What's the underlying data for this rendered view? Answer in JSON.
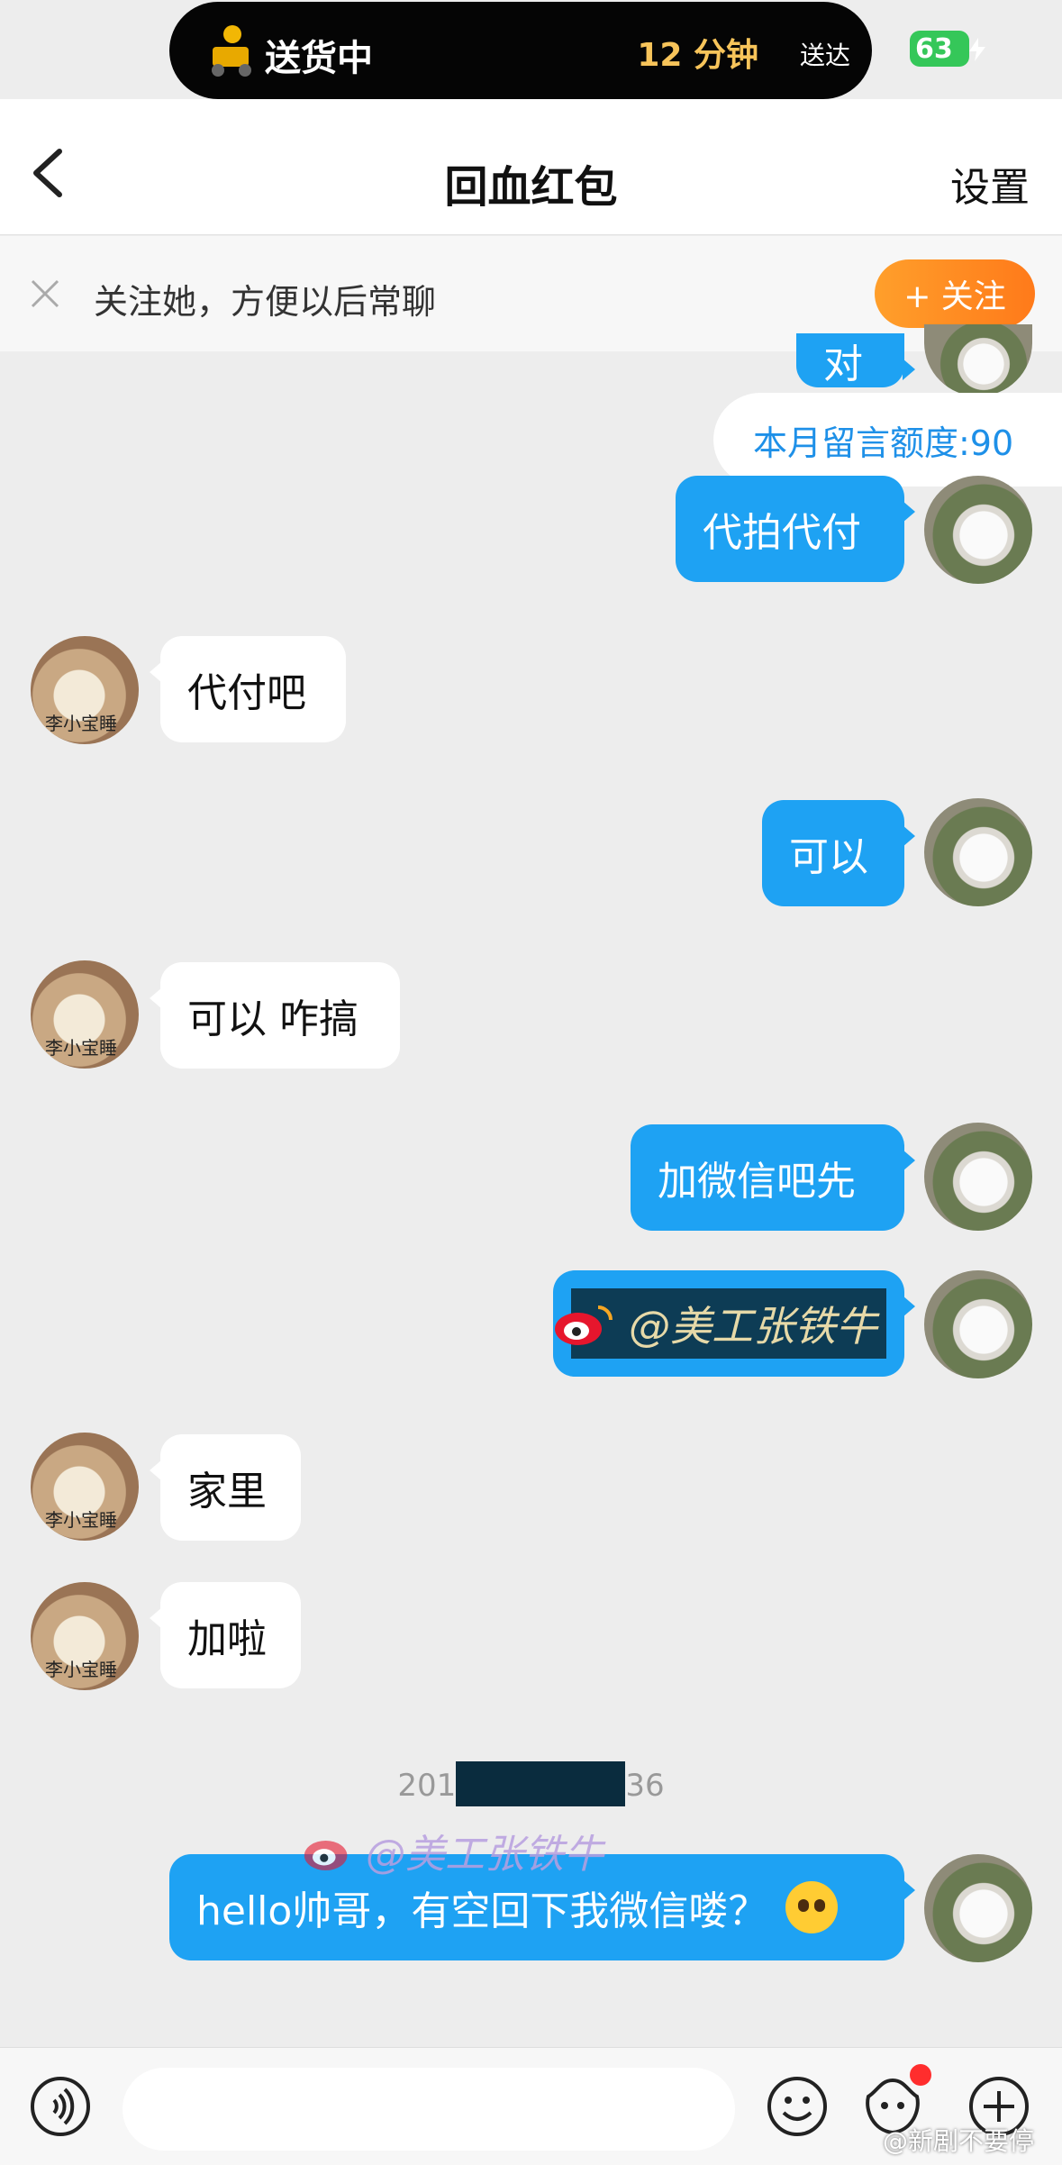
{
  "status": {
    "delivery_label": "送货中",
    "eta": "12 分钟",
    "eta_suffix": "送达",
    "battery": "63"
  },
  "header": {
    "title": "回血红包",
    "settings": "设置"
  },
  "follow_bar": {
    "tip": "关注她，方便以后常聊",
    "button": "+ 关注"
  },
  "quota": "本月留言额度:90",
  "messages": [
    {
      "from": "me",
      "text": "对"
    },
    {
      "from": "me",
      "text": "代拍代付"
    },
    {
      "from": "them",
      "text": "代付吧"
    },
    {
      "from": "me",
      "text": "可以"
    },
    {
      "from": "them",
      "text": "可以 咋搞"
    },
    {
      "from": "me",
      "text": "加微信吧先"
    },
    {
      "from": "me",
      "text": "@美工张铁牛"
    },
    {
      "from": "them",
      "text": "家里"
    },
    {
      "from": "them",
      "text": "加啦"
    },
    {
      "from": "me",
      "text": "hello帅哥，有空回下我微信喽？"
    }
  ],
  "contact_avatar_caption": "李小宝睡",
  "timestamp": {
    "prefix": "201",
    "suffix": "36"
  },
  "watermark": "@美工张铁牛",
  "bottom_credit": "@新剧不要停",
  "colors": {
    "my_bubble": "#1ea2f3",
    "their_bubble": "#ffffff",
    "follow": "#ff8a22",
    "quota_text": "#1e90e8"
  }
}
